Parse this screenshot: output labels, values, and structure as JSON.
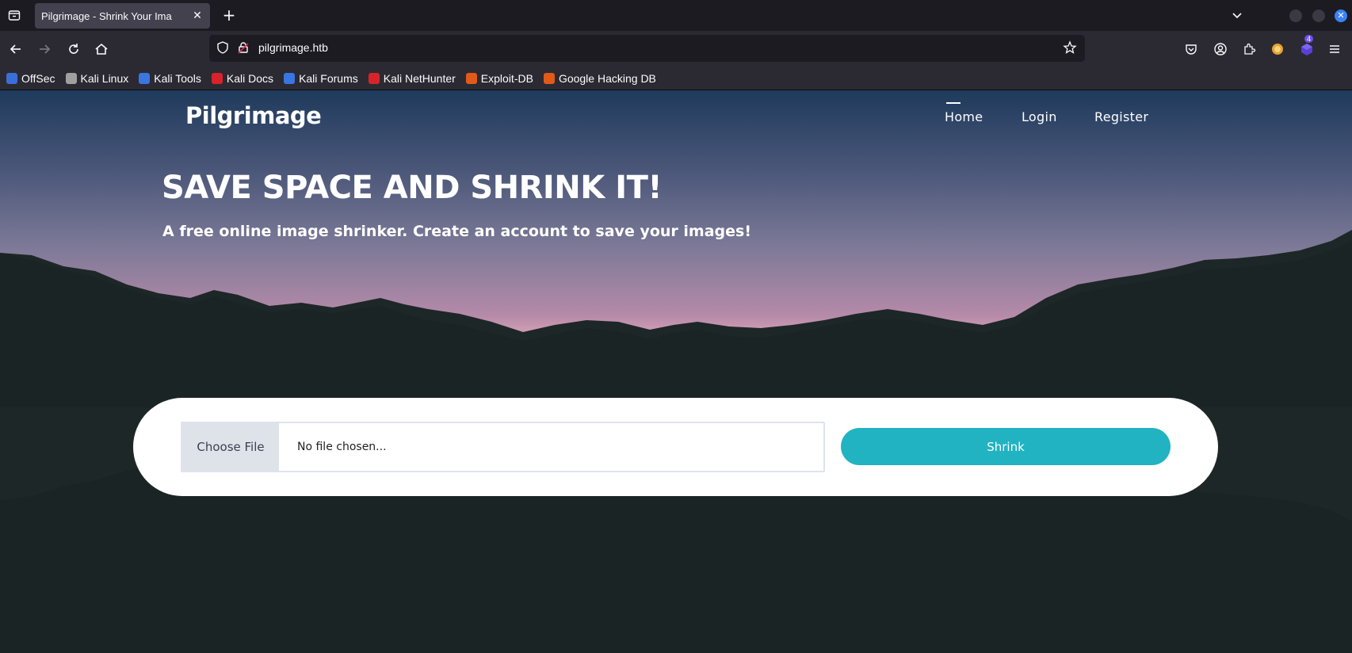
{
  "browser": {
    "tab_title": "Pilgrimage - Shrink Your Ima",
    "tab_close": "✕",
    "new_tab": "+",
    "url": "pilgrimage.htb",
    "extensions_badge": "4",
    "bookmarks": [
      {
        "label": "OffSec",
        "icon": "offsec-icon",
        "color": "#3b6fd8"
      },
      {
        "label": "Kali Linux",
        "icon": "kali-dragon-icon",
        "color": "#a0a0a0"
      },
      {
        "label": "Kali Tools",
        "icon": "kali-tools-icon",
        "color": "#3a76e0"
      },
      {
        "label": "Kali Docs",
        "icon": "kali-docs-icon",
        "color": "#d8232a"
      },
      {
        "label": "Kali Forums",
        "icon": "kali-forums-icon",
        "color": "#3a76e0"
      },
      {
        "label": "Kali NetHunter",
        "icon": "nethunter-icon",
        "color": "#d8232a"
      },
      {
        "label": "Exploit-DB",
        "icon": "exploit-db-icon",
        "color": "#e05a1a"
      },
      {
        "label": "Google Hacking DB",
        "icon": "ghdb-icon",
        "color": "#e05a1a"
      }
    ]
  },
  "site": {
    "brand": "Pilgrimage",
    "nav": {
      "home": "Home",
      "login": "Login",
      "register": "Register"
    },
    "hero": {
      "title": "SAVE SPACE AND SHRINK IT!",
      "subtitle": "A free online image shrinker. Create an account to save your images!"
    },
    "upload": {
      "choose_file": "Choose File",
      "file_status": "No file chosen...",
      "submit": "Shrink"
    },
    "colors": {
      "accent": "#21b3c1"
    }
  }
}
